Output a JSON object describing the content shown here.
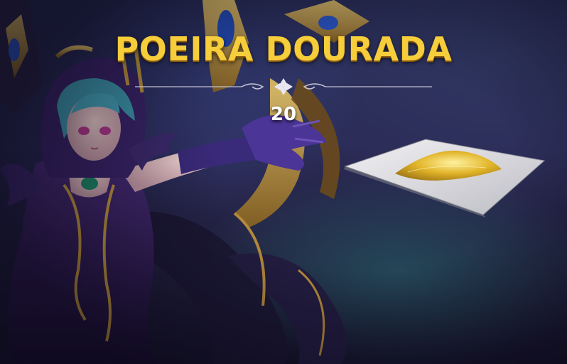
{
  "reward": {
    "title": "POEIRA DOURADA",
    "quantity": "20",
    "item_icon": "golden-dust-pile-icon"
  },
  "colors": {
    "title_gold": "#f6cd3a",
    "divider": "#c9c6d6",
    "dust": "#e2b52a"
  }
}
